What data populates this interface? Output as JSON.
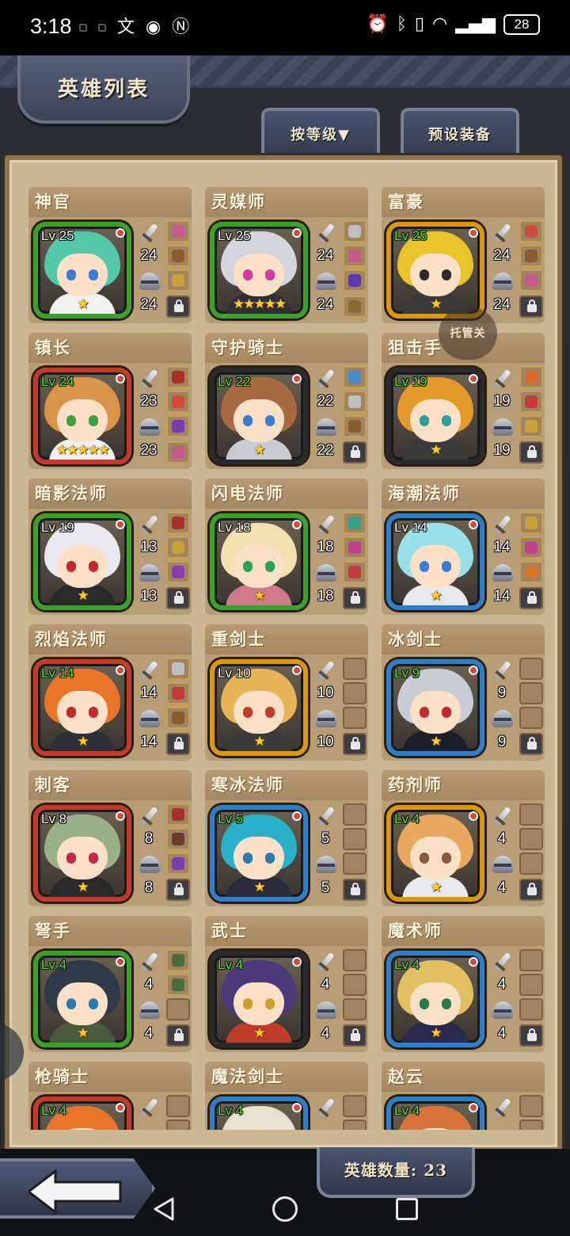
{
  "status_bar": {
    "time": "3:18",
    "battery": "28",
    "icons_left": [
      "notification-icon",
      "notification-icon",
      "notification-icon",
      "eye-icon",
      "nfc-icon"
    ],
    "icons_right": [
      "alarm-icon",
      "bluetooth-icon",
      "vibrate-icon",
      "wifi-icon",
      "signal-icon",
      "battery-icon"
    ]
  },
  "header": {
    "title": "英雄列表",
    "tab_sort": "按等级▼",
    "tab_preset": "预设装备"
  },
  "auto_badge": "托管关",
  "heroes": [
    {
      "name": "神官",
      "level": "Lv 25",
      "atk": "24",
      "def": "24",
      "stars": "★",
      "frame": "green",
      "hair": "#54c7a8",
      "eye": "#3b7bd6",
      "body": "#f1f1f1",
      "lv_green": false,
      "slots": [
        "#c65a8a",
        "#8a5c2e",
        "#c9a03a",
        "lock"
      ]
    },
    {
      "name": "灵媒师",
      "level": "Lv 25",
      "atk": "24",
      "def": "24",
      "stars": "★★★★★",
      "frame": "green",
      "hair": "#d4d4dc",
      "eye": "#d23aa0",
      "body": "#2f2f3a",
      "lv_green": false,
      "slots": [
        "#c0c0c0",
        "#c65a8a",
        "#5a3ab0",
        "#8a6a32"
      ]
    },
    {
      "name": "富豪",
      "level": "Lv 25",
      "atk": "24",
      "def": "24",
      "stars": "★",
      "frame": "orange",
      "hair": "#e8c42a",
      "eye": "#2a2a2a",
      "body": "#3a3a3a",
      "lv_green": true,
      "slots": [
        "#c8503a",
        "#8a5c2e",
        "#c65a8a",
        "lock"
      ]
    },
    {
      "name": "镇长",
      "level": "Lv 24",
      "atk": "23",
      "def": "23",
      "stars": "★★★★★",
      "frame": "red",
      "hair": "#d9944a",
      "eye": "#3aa040",
      "body": "#f1f1f1",
      "lv_green": true,
      "slots": [
        "#a8322a",
        "#d24a3a",
        "#7a3ab0",
        "#c65a8a"
      ]
    },
    {
      "name": "守护骑士",
      "level": "Lv 22",
      "atk": "22",
      "def": "22",
      "stars": "★",
      "frame": "black",
      "hair": "#a86a42",
      "eye": "#3b7bd6",
      "body": "#c9c9d2",
      "lv_green": true,
      "slots": [
        "#4a8ac8",
        "#c0c0c0",
        "#8a5c2e",
        "lock"
      ]
    },
    {
      "name": "狙击手",
      "level": "Lv 19",
      "atk": "19",
      "def": "19",
      "stars": "★",
      "frame": "black",
      "hair": "#e39a2a",
      "eye": "#2ba0a0",
      "body": "#3a3a3a",
      "lv_green": true,
      "slots": [
        "#d86a2a",
        "#c23a3a",
        "#c9a03a",
        "lock"
      ]
    },
    {
      "name": "暗影法师",
      "level": "Lv 19",
      "atk": "13",
      "def": "13",
      "stars": "★",
      "frame": "green",
      "hair": "#e8e8ee",
      "eye": "#c22a2a",
      "body": "#2a2a2a",
      "lv_green": false,
      "slots": [
        "#a8322a",
        "#c9a03a",
        "#8a3ab0",
        "lock"
      ]
    },
    {
      "name": "闪电法师",
      "level": "Lv 18",
      "atk": "18",
      "def": "18",
      "stars": "★",
      "frame": "green",
      "hair": "#f3e0b0",
      "eye": "#2aa05a",
      "body": "#d07a8a",
      "lv_green": false,
      "slots": [
        "#3aa08a",
        "#c0428a",
        "#c23a3a",
        "lock"
      ]
    },
    {
      "name": "海潮法师",
      "level": "Lv 14",
      "atk": "14",
      "def": "14",
      "stars": "★",
      "frame": "blue",
      "hair": "#9ae0e8",
      "eye": "#3b7bd6",
      "body": "#e8e8ee",
      "lv_green": false,
      "slots": [
        "#c9a03a",
        "#c0428a",
        "#d8742a",
        "lock"
      ]
    },
    {
      "name": "烈焰法师",
      "level": "Lv 14",
      "atk": "14",
      "def": "14",
      "stars": "★",
      "frame": "red",
      "hair": "#e8742a",
      "eye": "#c22a2a",
      "body": "#2f2f3a",
      "lv_green": true,
      "slots": [
        "#c0c0c0",
        "#c23a3a",
        "#8a5c2e",
        "lock"
      ]
    },
    {
      "name": "重剑士",
      "level": "Lv 10",
      "atk": "10",
      "def": "10",
      "stars": "★",
      "frame": "orange",
      "hair": "#e8b45a",
      "eye": "#c23a2a",
      "body": "#3a3a3a",
      "lv_green": false,
      "slots": [
        "empty",
        "empty",
        "empty",
        "lock"
      ]
    },
    {
      "name": "冰剑士",
      "level": "Lv 9",
      "atk": "9",
      "def": "9",
      "stars": "★",
      "frame": "blue",
      "hair": "#c8ccd4",
      "eye": "#c22a2a",
      "body": "#1f1f2a",
      "lv_green": true,
      "slots": [
        "empty",
        "empty",
        "empty",
        "lock"
      ]
    },
    {
      "name": "刺客",
      "level": "Lv 8",
      "atk": "8",
      "def": "8",
      "stars": "★",
      "frame": "red",
      "hair": "#9ab08a",
      "eye": "#c2284a",
      "body": "#2a2a2a",
      "lv_green": false,
      "slots": [
        "#a8322a",
        "#6a3a2a",
        "#7a3ab0",
        "lock"
      ]
    },
    {
      "name": "寒冰法师",
      "level": "Lv 5",
      "atk": "5",
      "def": "5",
      "stars": "★",
      "frame": "blue",
      "hair": "#2ab0c8",
      "eye": "#2a7ab0",
      "body": "#2a2a3a",
      "lv_green": true,
      "slots": [
        "empty",
        "empty",
        "empty",
        "lock"
      ]
    },
    {
      "name": "药剂师",
      "level": "Lv 4",
      "atk": "4",
      "def": "4",
      "stars": "★",
      "frame": "orange",
      "hair": "#e8a860",
      "eye": "#8a5a3a",
      "body": "#e8e8ee",
      "lv_green": true,
      "slots": [
        "empty",
        "empty",
        "empty",
        "lock"
      ]
    },
    {
      "name": "弩手",
      "level": "Lv 4",
      "atk": "4",
      "def": "4",
      "stars": "★",
      "frame": "green",
      "hair": "#2f3a48",
      "eye": "#2a7ab0",
      "body": "#4a5a3a",
      "lv_green": true,
      "slots": [
        "#4a6a3a",
        "#4a6a3a",
        "empty",
        "lock"
      ]
    },
    {
      "name": "武士",
      "level": "Lv 4",
      "atk": "4",
      "def": "4",
      "stars": "★",
      "frame": "black",
      "hair": "#4a3a78",
      "eye": "#c8a02a",
      "body": "#c23a2a",
      "lv_green": true,
      "slots": [
        "empty",
        "empty",
        "empty",
        "lock"
      ]
    },
    {
      "name": "魔术师",
      "level": "Lv 4",
      "atk": "4",
      "def": "4",
      "stars": "★",
      "frame": "blue",
      "hair": "#e0c060",
      "eye": "#2a7a4a",
      "body": "#2a2a4a",
      "lv_green": true,
      "slots": [
        "empty",
        "empty",
        "empty",
        "lock"
      ]
    },
    {
      "name": "枪骑士",
      "level": "Lv 4",
      "atk": "",
      "def": "",
      "stars": "",
      "frame": "red",
      "hair": "#e8742a",
      "eye": "#2a2a2a",
      "body": "#2a2a2a",
      "lv_green": true,
      "slots": [
        "empty",
        "empty",
        "empty",
        "lock"
      ]
    },
    {
      "name": "魔法剑士",
      "level": "Lv 4",
      "atk": "",
      "def": "",
      "stars": "",
      "frame": "blue",
      "hair": "#e8e0d0",
      "eye": "#2a2a2a",
      "body": "#2a2a2a",
      "lv_green": true,
      "slots": [
        "empty",
        "empty",
        "empty",
        "lock"
      ]
    },
    {
      "name": "赵云",
      "level": "Lv 4",
      "atk": "",
      "def": "",
      "stars": "",
      "frame": "blue",
      "hair": "#d8743a",
      "eye": "#2a2a2a",
      "body": "#2a2a2a",
      "lv_green": true,
      "slots": [
        "empty",
        "empty",
        "empty",
        "lock"
      ]
    }
  ],
  "footer": {
    "hero_count": "英雄数量: 23"
  }
}
